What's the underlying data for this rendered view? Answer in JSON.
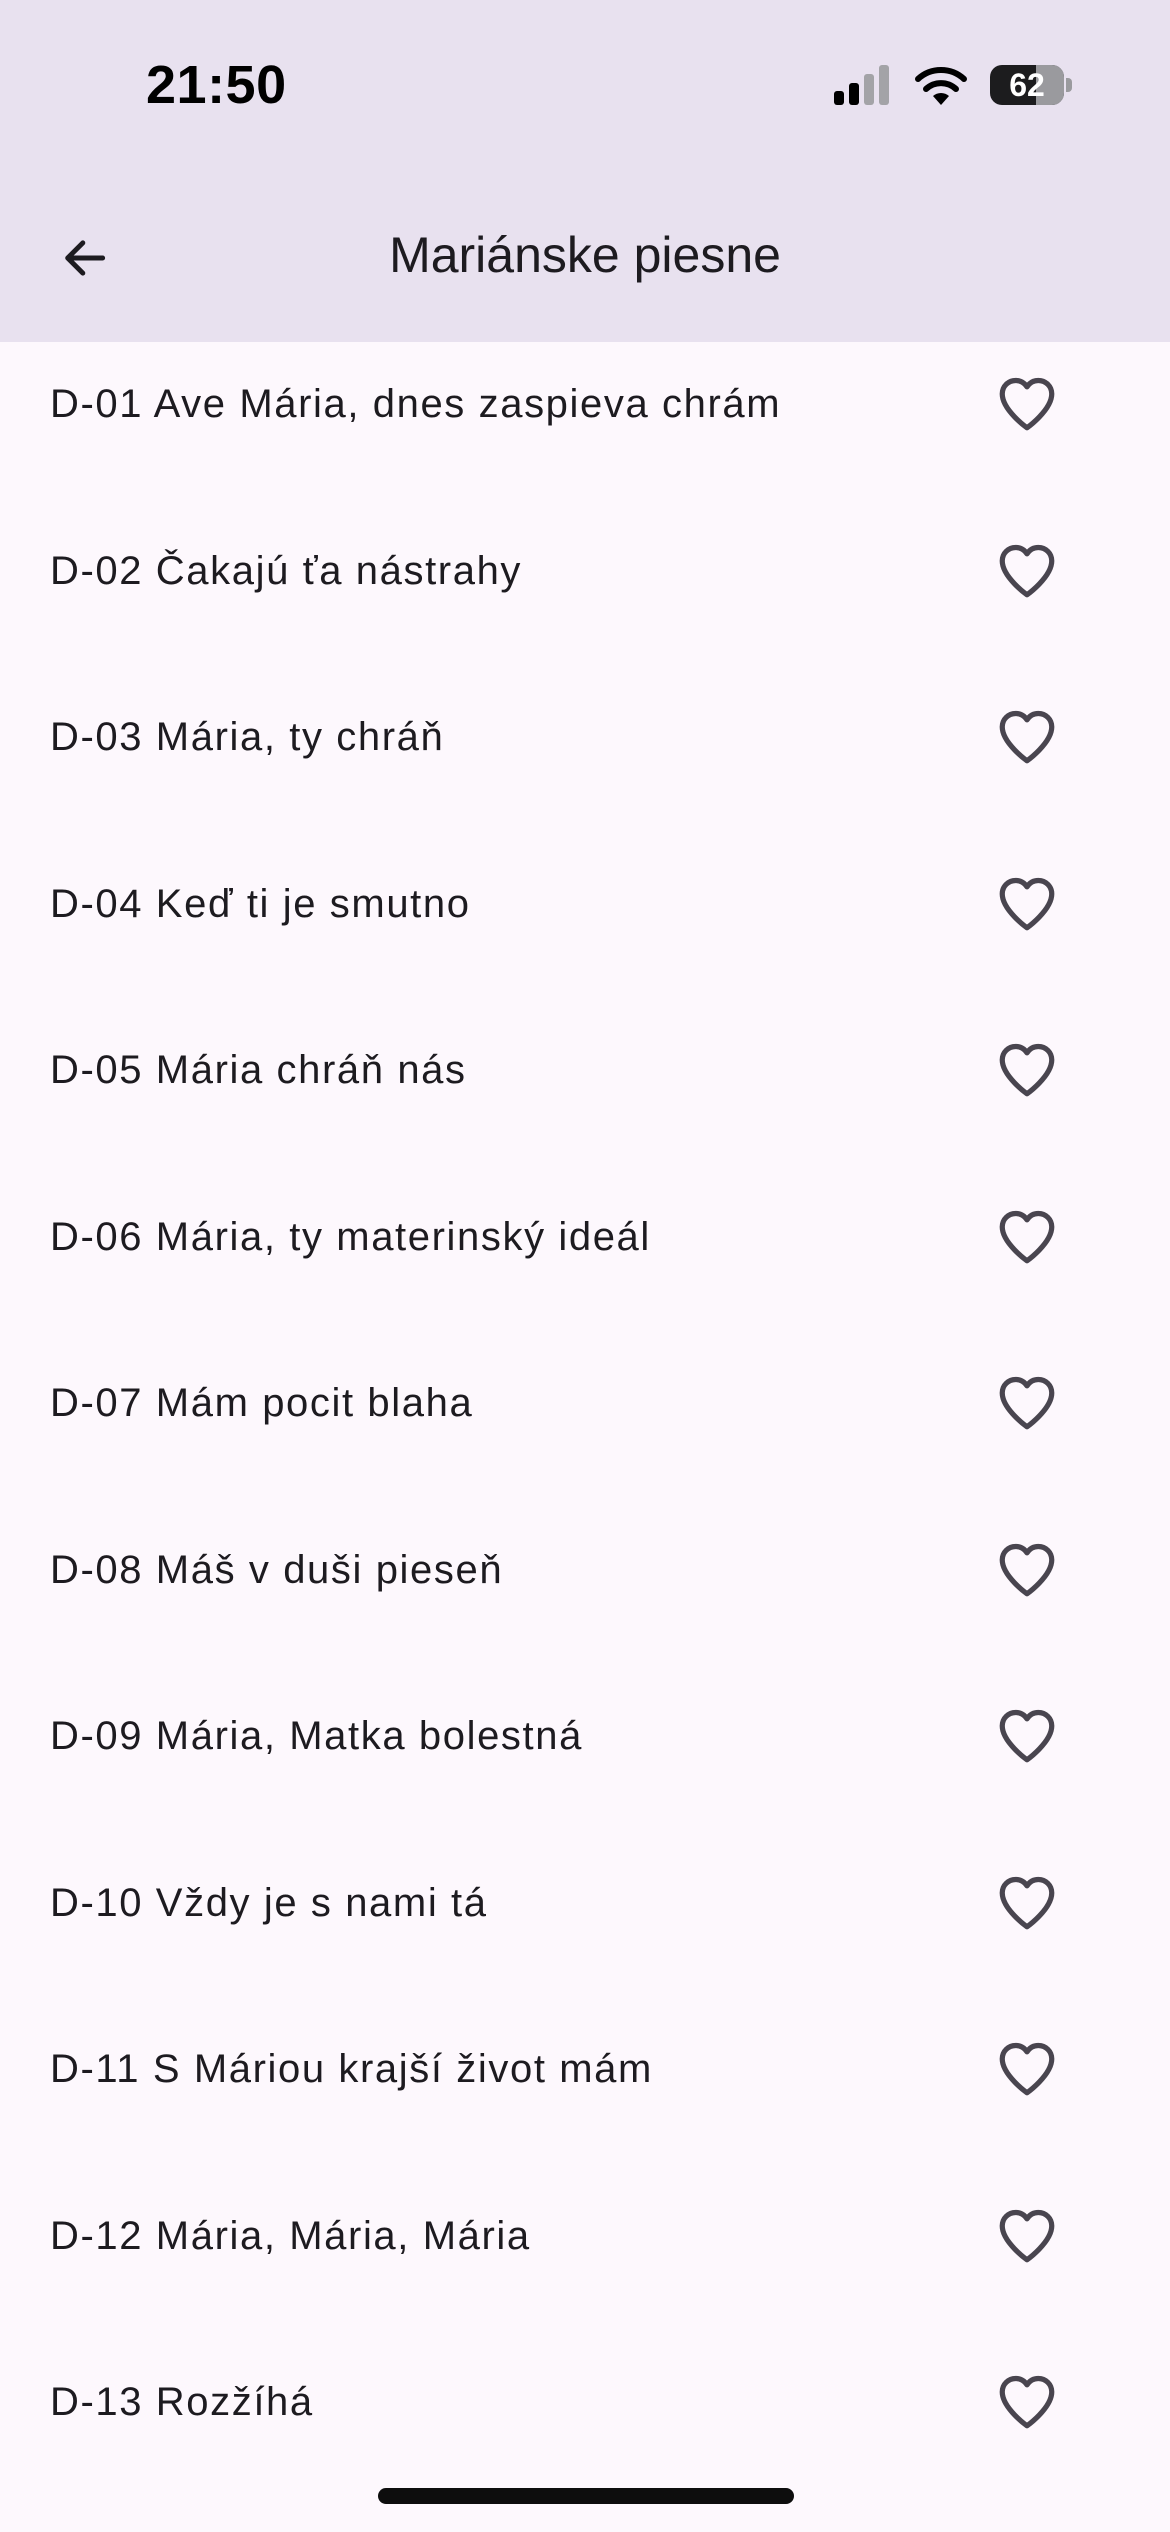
{
  "status_bar": {
    "time": "21:50",
    "battery": "62",
    "icons": [
      "cellular-signal-icon",
      "wifi-icon",
      "battery-icon"
    ]
  },
  "app_bar": {
    "title": "Mariánske piesne",
    "back_icon": "arrow-left-icon"
  },
  "songs": [
    {
      "label": "D-01 Ave Mária, dnes zaspieva chrám",
      "favorite": false
    },
    {
      "label": "D-02 Čakajú ťa nástrahy",
      "favorite": false
    },
    {
      "label": "D-03 Mária, ty chráň",
      "favorite": false
    },
    {
      "label": "D-04 Keď ti je smutno",
      "favorite": false
    },
    {
      "label": "D-05 Mária chráň nás",
      "favorite": false
    },
    {
      "label": "D-06 Mária, ty materinský ideál",
      "favorite": false
    },
    {
      "label": "D-07 Mám pocit blaha",
      "favorite": false
    },
    {
      "label": "D-08 Máš v duši pieseň",
      "favorite": false
    },
    {
      "label": "D-09 Mária, Matka bolestná",
      "favorite": false
    },
    {
      "label": "D-10 Vždy je s nami tá",
      "favorite": false
    },
    {
      "label": "D-11 S Máriou krajší život mám",
      "favorite": false
    },
    {
      "label": "D-12 Mária, Mária, Mária",
      "favorite": false
    },
    {
      "label": "D-13 Rozžíhá",
      "favorite": false
    }
  ],
  "colors": {
    "app_bar_bg": "#e8e1ef",
    "page_bg": "#fdf8fd",
    "text": "#1d1b20",
    "icon": "#49454f"
  }
}
